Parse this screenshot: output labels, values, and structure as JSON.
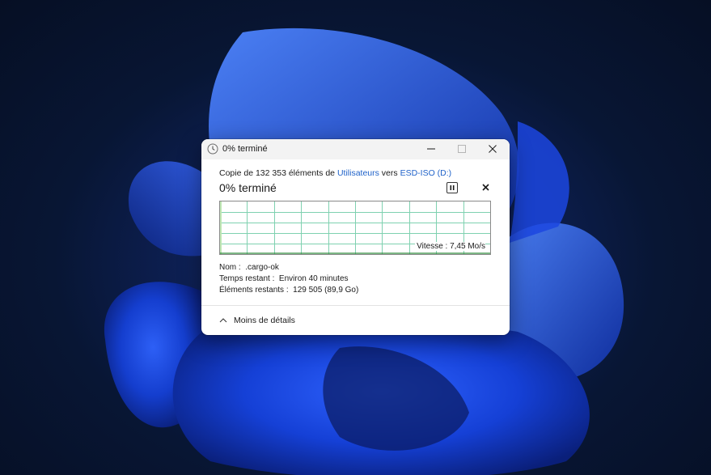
{
  "window": {
    "title": "0% terminé"
  },
  "copy": {
    "prefix": "Copie de 132 353 éléments de ",
    "source": "Utilisateurs",
    "middle": " vers ",
    "destination": "ESD-ISO (D:)",
    "percent_label": "0% terminé",
    "progress_fraction": 0.0
  },
  "graph": {
    "speed_label": "Vitesse : 7,45 Mo/s",
    "grid_color": "#7fd1b0",
    "fill_color": "#bfe8b4"
  },
  "details": {
    "name_label": "Nom :",
    "name_value": ".cargo-ok",
    "time_label": "Temps restant :",
    "time_value": "Environ 40 minutes",
    "items_label": "Éléments restants :",
    "items_value": "129 505 (89,9 Go)"
  },
  "footer": {
    "less_details_label": "Moins de détails"
  },
  "icons": {
    "title": "clock-icon",
    "minimize": "minimize-icon",
    "maximize": "maximize-icon",
    "close": "close-icon",
    "pause": "pause-icon",
    "cancel": "cancel-icon",
    "chevron": "chevron-up-icon"
  },
  "colors": {
    "link": "#1f62c9",
    "titlebar": "#f3f3f3"
  }
}
